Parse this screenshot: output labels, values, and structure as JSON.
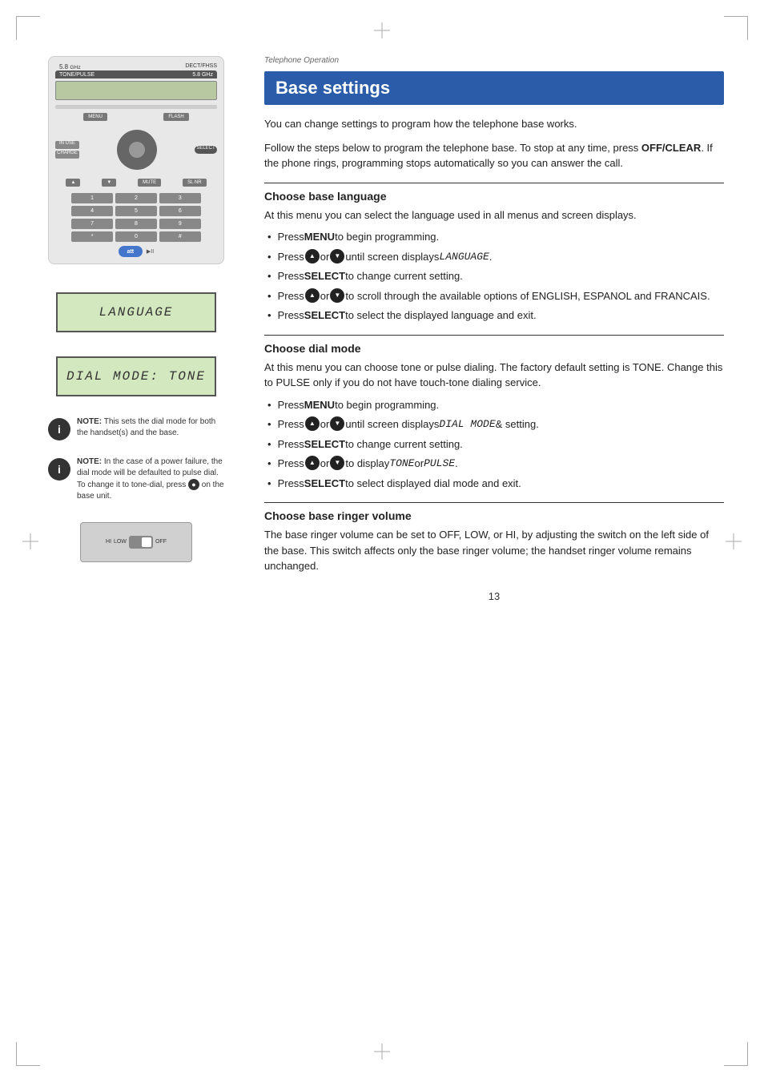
{
  "page": {
    "section_label": "Telephone Operation",
    "page_number": "13",
    "title": "Base settings",
    "intro1": "You can change settings to program how the telephone base works.",
    "intro2": "Follow the steps below to program the telephone base. To stop at any time, press ",
    "intro2_bold": "OFF/CLEAR",
    "intro2_end": ". If the phone rings, programming stops automatically so you can answer the call.",
    "sections": [
      {
        "id": "choose-base-language",
        "title": "Choose base language",
        "desc": "At this menu you can select the language used in all menus and screen displays.",
        "bullets": [
          {
            "text": "Press ",
            "bold": "MENU",
            "end": " to begin programming."
          },
          {
            "text": "Press ",
            "icon_up": true,
            "mid": " or ",
            "icon_down": true,
            "end2": " until screen displays ",
            "mono": "LANGUAGE",
            "end3": "."
          },
          {
            "text": "Press ",
            "bold": "SELECT",
            "end": " to change current setting."
          },
          {
            "text": "Press ",
            "icon_up": true,
            "mid": " or ",
            "icon_down": true,
            "end2": " to scroll through the available options of ENGLISH, ESPANOL and FRANCAIS."
          },
          {
            "text": "Press ",
            "bold": "SELECT",
            "end": " to select the displayed language and exit."
          }
        ]
      },
      {
        "id": "choose-dial-mode",
        "title": "Choose dial mode",
        "desc": "At this menu you can choose tone or pulse dialing. The factory default setting is TONE. Change this to PULSE only if you do not have touch-tone dialing service.",
        "bullets": [
          {
            "text": "Press ",
            "bold": "MENU",
            "end": " to begin programming."
          },
          {
            "text": "Press ",
            "icon_up": true,
            "mid": " or ",
            "icon_down": true,
            "end2": " until screen displays ",
            "mono": "DIAL MODE",
            "end3": " & setting."
          },
          {
            "text": "Press ",
            "bold": "SELECT",
            "end": " to change current setting."
          },
          {
            "text": "Press ",
            "icon_up": true,
            "mid": " or ",
            "icon_down": true,
            "end2": " to display ",
            "mono2": "TONE",
            "end4": " or ",
            "mono3": "PULSE",
            "end5": "."
          },
          {
            "text": "Press ",
            "bold": "SELECT",
            "end": " to select displayed dial mode and exit."
          }
        ]
      },
      {
        "id": "choose-base-ringer-volume",
        "title": "Choose base ringer volume",
        "desc": "The base ringer volume can be set to OFF, LOW, or HI, by adjusting the switch on the left side of the base. This switch affects only the base ringer volume; the handset ringer volume remains unchanged."
      }
    ],
    "left_side": {
      "lcd_language": "LANGUAGE",
      "lcd_dial_mode": "DIAL MODE: TONE",
      "note1_bold": "NOTE:",
      "note1_text": " This sets the dial mode for both the handset(s) and the base.",
      "note2_bold": "NOTE:",
      "note2_text": " In the case of a power failure, the dial mode will be defaulted to pulse dial. To change it to tone-dial, press ",
      "note2_icon": "●",
      "note2_end": " on the base unit."
    }
  }
}
